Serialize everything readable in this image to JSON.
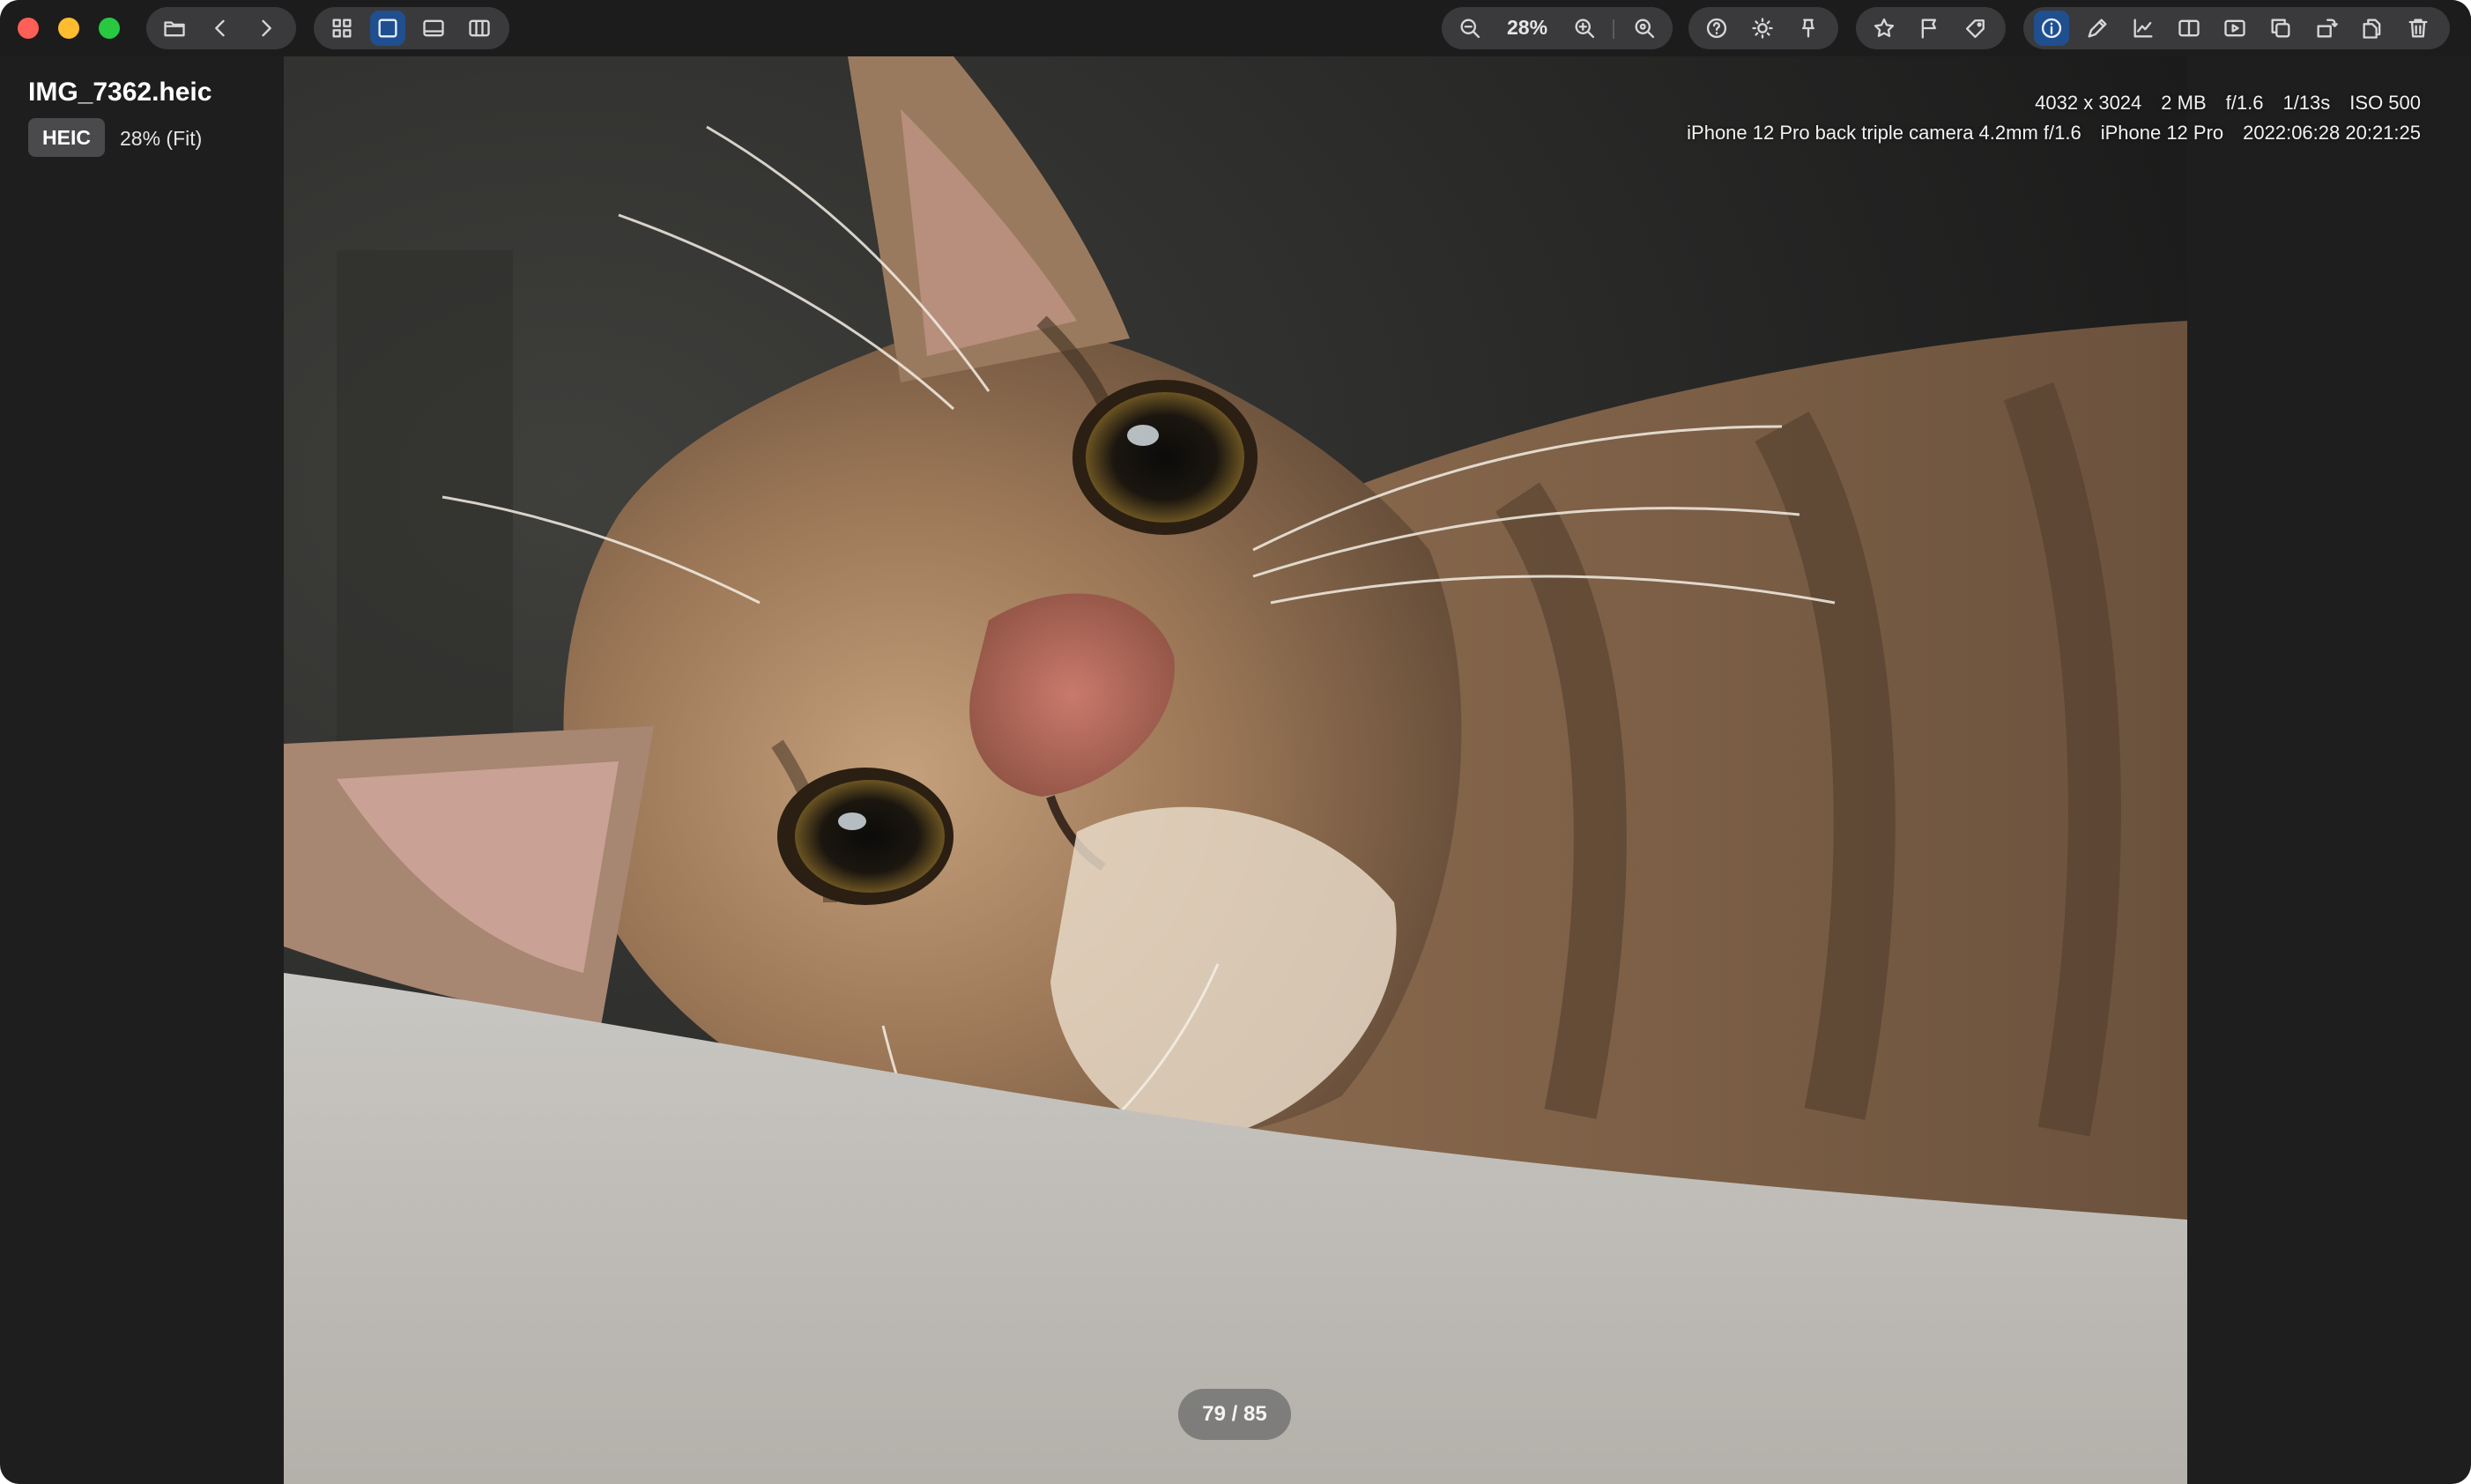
{
  "file": {
    "name": "IMG_7362.heic",
    "format_badge": "HEIC",
    "zoom_info": "28% (Fit)"
  },
  "toolbar": {
    "zoom_value": "28%",
    "active_view": "single-view",
    "active_panel": "info"
  },
  "exif": {
    "dimensions": "4032 x 3024",
    "file_size": "2 MB",
    "aperture": "f/1.6",
    "shutter": "1/13s",
    "iso": "ISO 500",
    "lens": "iPhone 12 Pro back triple camera 4.2mm f/1.6",
    "camera": "iPhone 12 Pro",
    "datetime": "2022:06:28 20:21:25"
  },
  "navigation": {
    "counter": "79 / 85"
  },
  "colors": {
    "window_bg": "#1e1e1f",
    "toolbar_group": "#3a3a3c",
    "active_accent": "#1f4f8f"
  }
}
